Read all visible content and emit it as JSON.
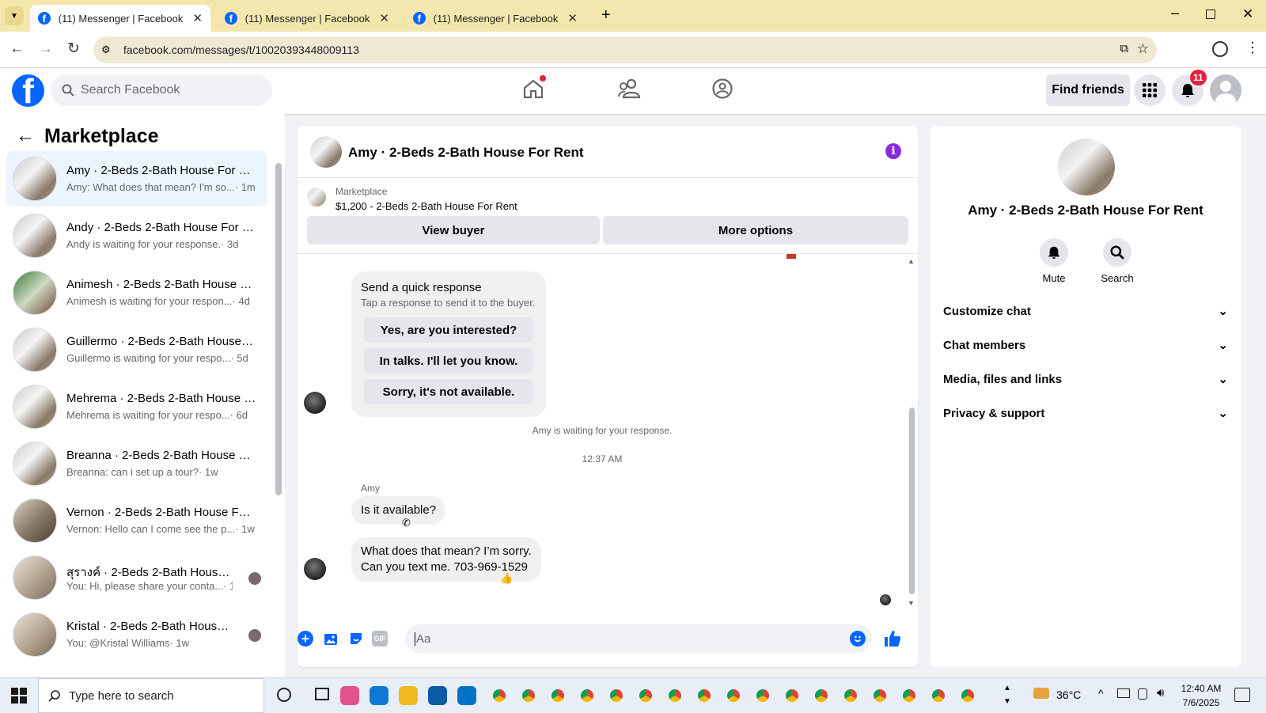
{
  "browser": {
    "tabs": [
      {
        "title": "(11) Messenger | Facebook"
      },
      {
        "title": "(11) Messenger | Facebook"
      },
      {
        "title": "(11) Messenger | Facebook"
      }
    ],
    "url": "facebook.com/messages/t/10020393448009113"
  },
  "header": {
    "search_placeholder": "Search Facebook",
    "find_friends": "Find friends",
    "notification_count": "11"
  },
  "sidebar": {
    "title": "Marketplace",
    "conversations": [
      {
        "name": "Amy · 2-Beds 2-Bath House For Rent",
        "preview": "Amy: What does that mean? I'm so...",
        "time": "· 1m",
        "selected": true
      },
      {
        "name": "Andy · 2-Beds 2-Bath House For Rent",
        "preview": "Andy is waiting for your response.",
        "time": "· 3d"
      },
      {
        "name": "Animesh · 2-Beds 2-Bath House For Rent",
        "preview": "Animesh is waiting for your respon...",
        "time": "· 4d"
      },
      {
        "name": "Guillermo · 2-Beds 2-Bath House For Rent",
        "preview": "Guillermo is waiting for your respo...",
        "time": "· 5d"
      },
      {
        "name": "Mehrema · 2-Beds 2-Bath House For Rent",
        "preview": "Mehrema is waiting for your respo...",
        "time": "· 6d"
      },
      {
        "name": "Breanna · 2-Beds 2-Bath House For Rent",
        "preview": "Breanna: can i set up a tour?",
        "time": "· 1w"
      },
      {
        "name": "Vernon · 2-Beds 2-Bath House For Rent",
        "preview": "Vernon: Hello can I come see the p...",
        "time": "· 1w"
      },
      {
        "name": "สุรางค์ · 2-Beds 2-Bath House For Rent",
        "preview": "You: Hi, please share your conta...",
        "time": "· 1w"
      },
      {
        "name": "Kristal · 2-Beds 2-Bath House For Rent",
        "preview": "You: @Kristal Williams",
        "time": "· 1w"
      }
    ]
  },
  "chat": {
    "title": "Amy · 2-Beds 2-Bath House For Rent",
    "listing_label": "Marketplace",
    "listing_price_title": "$1,200 - 2-Beds 2-Bath House For Rent",
    "view_buyer": "View buyer",
    "more_options": "More options",
    "quick_response": {
      "title": "Send a quick response",
      "subtitle": "Tap a response to send it to the buyer.",
      "options": [
        "Yes, are you interested?",
        "In talks. I'll let you know.",
        "Sorry, it's not available."
      ]
    },
    "waiting_note": "Amy is waiting for your response.",
    "timestamp": "12:37 AM",
    "sender": "Amy",
    "msg1": "Is it available?",
    "msg2_line1": "What does that mean? I’m sorry.",
    "msg2_line2": "Can you text me. 703-969-1529",
    "input_placeholder": "Aa"
  },
  "details": {
    "name": "Amy · 2-Beds 2-Bath House For Rent",
    "mute": "Mute",
    "search": "Search",
    "sections": [
      "Customize chat",
      "Chat members",
      "Media, files and links",
      "Privacy & support"
    ]
  },
  "taskbar": {
    "search_placeholder": "Type here to search",
    "temperature": "36°C",
    "time": "12:40 AM",
    "date": "7/6/2025"
  },
  "colors": {
    "brand": "#0866ff",
    "accent_purple": "#8a2be2",
    "notif_red": "#e41e3f"
  }
}
